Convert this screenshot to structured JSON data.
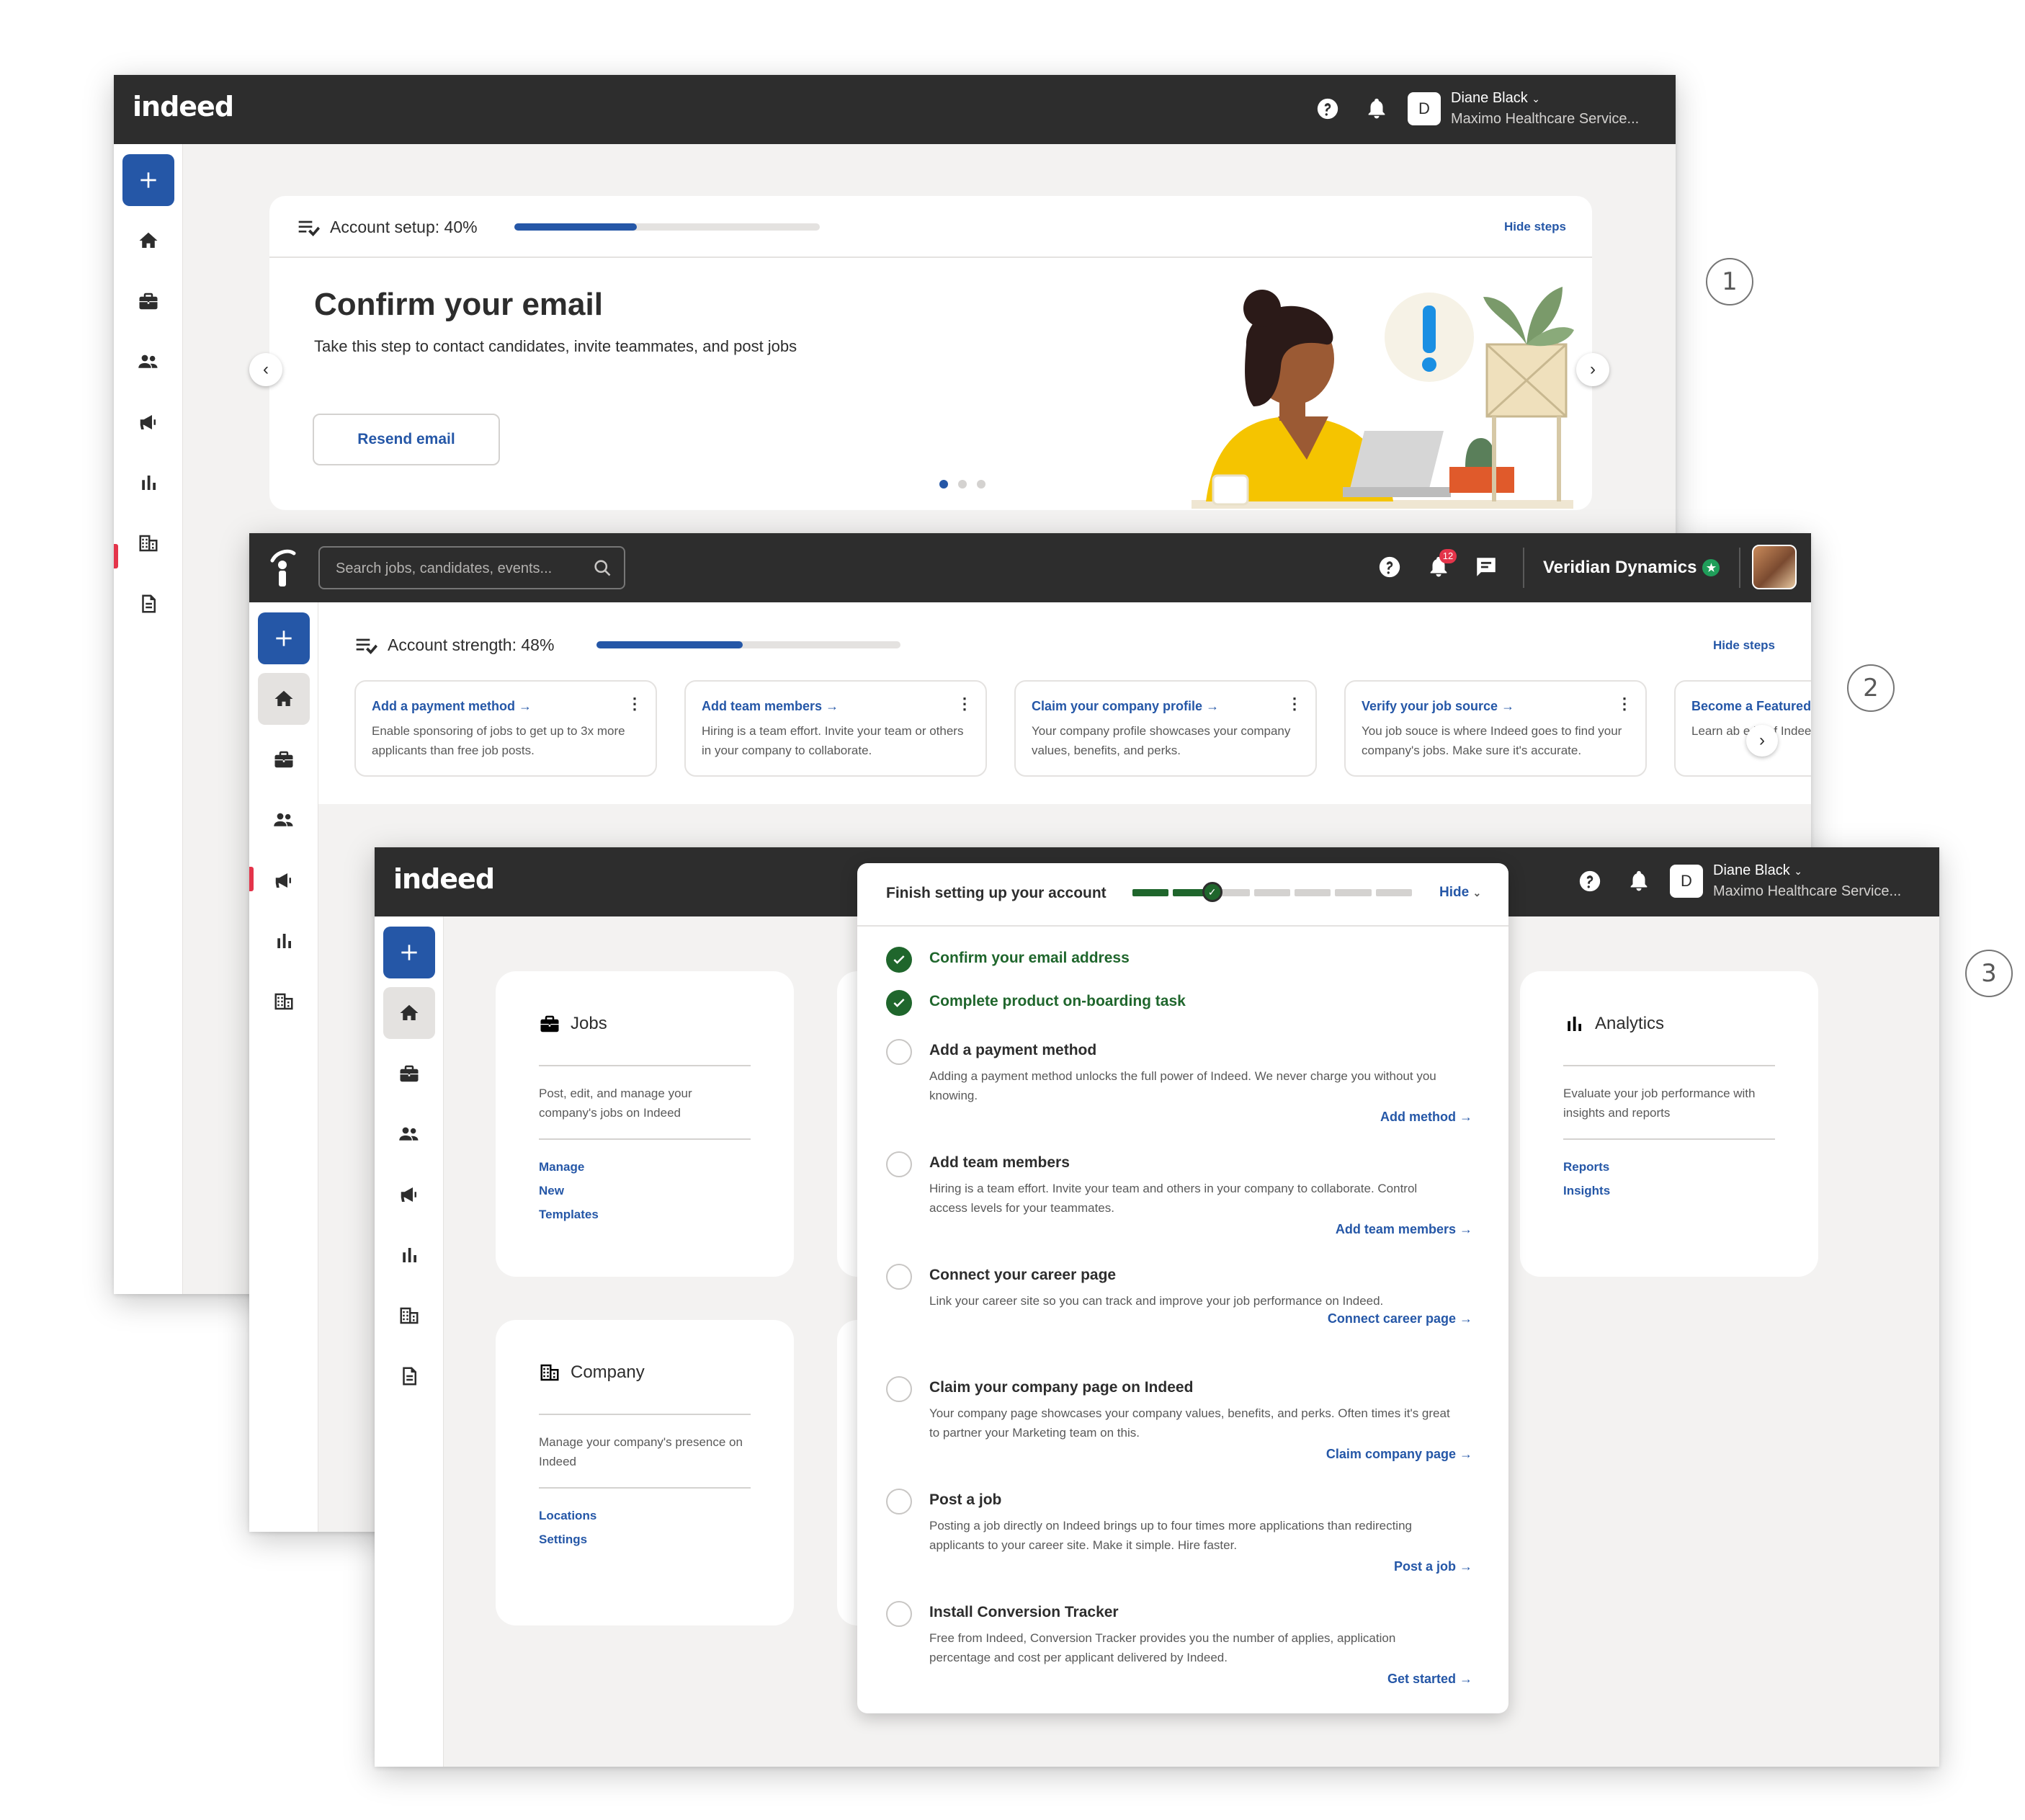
{
  "callouts": [
    "1",
    "2",
    "3"
  ],
  "screen1": {
    "logo": "indeed",
    "user_name": "Diane Black",
    "user_org": "Maximo Healthcare Service...",
    "avatar_letter": "D",
    "setup_label": "Account setup: 40%",
    "setup_progress": 0.4,
    "hide_steps": "Hide steps",
    "confirm_title": "Confirm your email",
    "confirm_desc": "Take this step to contact candidates, invite teammates, and post jobs",
    "resend_button": "Resend email",
    "carousel_dots": 3,
    "carousel_active": 0
  },
  "screen2": {
    "search_placeholder": "Search jobs, candidates, events...",
    "notif_count": "12",
    "company": "Veridian Dynamics",
    "strength_label": "Account strength: 48%",
    "strength_progress": 0.48,
    "hide_steps": "Hide steps",
    "steps": [
      {
        "title": "Add a payment method",
        "desc": "Enable sponsoring of jobs to get up to 3x more applicants than free job posts."
      },
      {
        "title": "Add team members",
        "desc": "Hiring is a team effort. Invite your team or others in your company to collaborate."
      },
      {
        "title": "Claim your company profile",
        "desc": "Your company profile showcases your company values, benefits, and perks."
      },
      {
        "title": "Verify your job source",
        "desc": "You job souce is where Indeed goes to find your company's jobs. Make sure it's accurate."
      },
      {
        "title": "Become a Featured",
        "desc": "Learn ab e benf Indeed Featured Emp"
      }
    ]
  },
  "screen3": {
    "logo": "indeed",
    "user_name": "Diane Black",
    "user_org": "Maximo Healthcare Service...",
    "avatar_letter": "D",
    "panel": {
      "title": "Finish setting up your account",
      "hide": "Hide",
      "progress_done": 2,
      "progress_total": 7,
      "items": [
        {
          "title": "Confirm your email address",
          "done": true
        },
        {
          "title": "Complete product on-boarding task",
          "done": true
        },
        {
          "title": "Add a payment method",
          "desc": "Adding a payment method unlocks the full power of Indeed. We never charge you without you knowing.",
          "action": "Add method"
        },
        {
          "title": "Add team members",
          "desc": "Hiring is a team effort. Invite your team and others in your company to collaborate. Control access levels for your teammates.",
          "action": "Add team members"
        },
        {
          "title": "Connect your career page",
          "desc": "Link your career site so you can track and improve your job  performance on Indeed.",
          "action": "Connect career page"
        },
        {
          "title": "Claim your company page on Indeed",
          "desc": "Your company page showcases your company values, benefits, and perks. Often times it's great to partner your Marketing team on this.",
          "action": "Claim company page"
        },
        {
          "title": "Post a job",
          "desc": "Posting a job directly on Indeed brings up to four times more applications than redirecting applicants to your career site. Make it simple. Hire faster.",
          "action": "Post a job"
        },
        {
          "title": "Install Conversion Tracker",
          "desc": "Free from Indeed, Conversion Tracker provides you the number of applies, application percentage and cost per applicant delivered by Indeed.",
          "action": "Get started"
        }
      ]
    },
    "jobs": {
      "title": "Jobs",
      "desc": "Post, edit, and manage your company's jobs on Indeed",
      "links": [
        "Manage",
        "New",
        "Templates"
      ]
    },
    "company": {
      "title": "Company",
      "desc": "Manage your company's presence on Indeed",
      "links": [
        "Locations",
        "Settings"
      ]
    },
    "analytics": {
      "title": "Analytics",
      "desc": "Evaluate your job performance with insights and reports",
      "links": [
        "Reports",
        "Insights"
      ]
    }
  },
  "colors": {
    "accent": "#2557a7",
    "topbar": "#2d2d2d",
    "success": "#1f662c",
    "alert": "#e4344a"
  }
}
